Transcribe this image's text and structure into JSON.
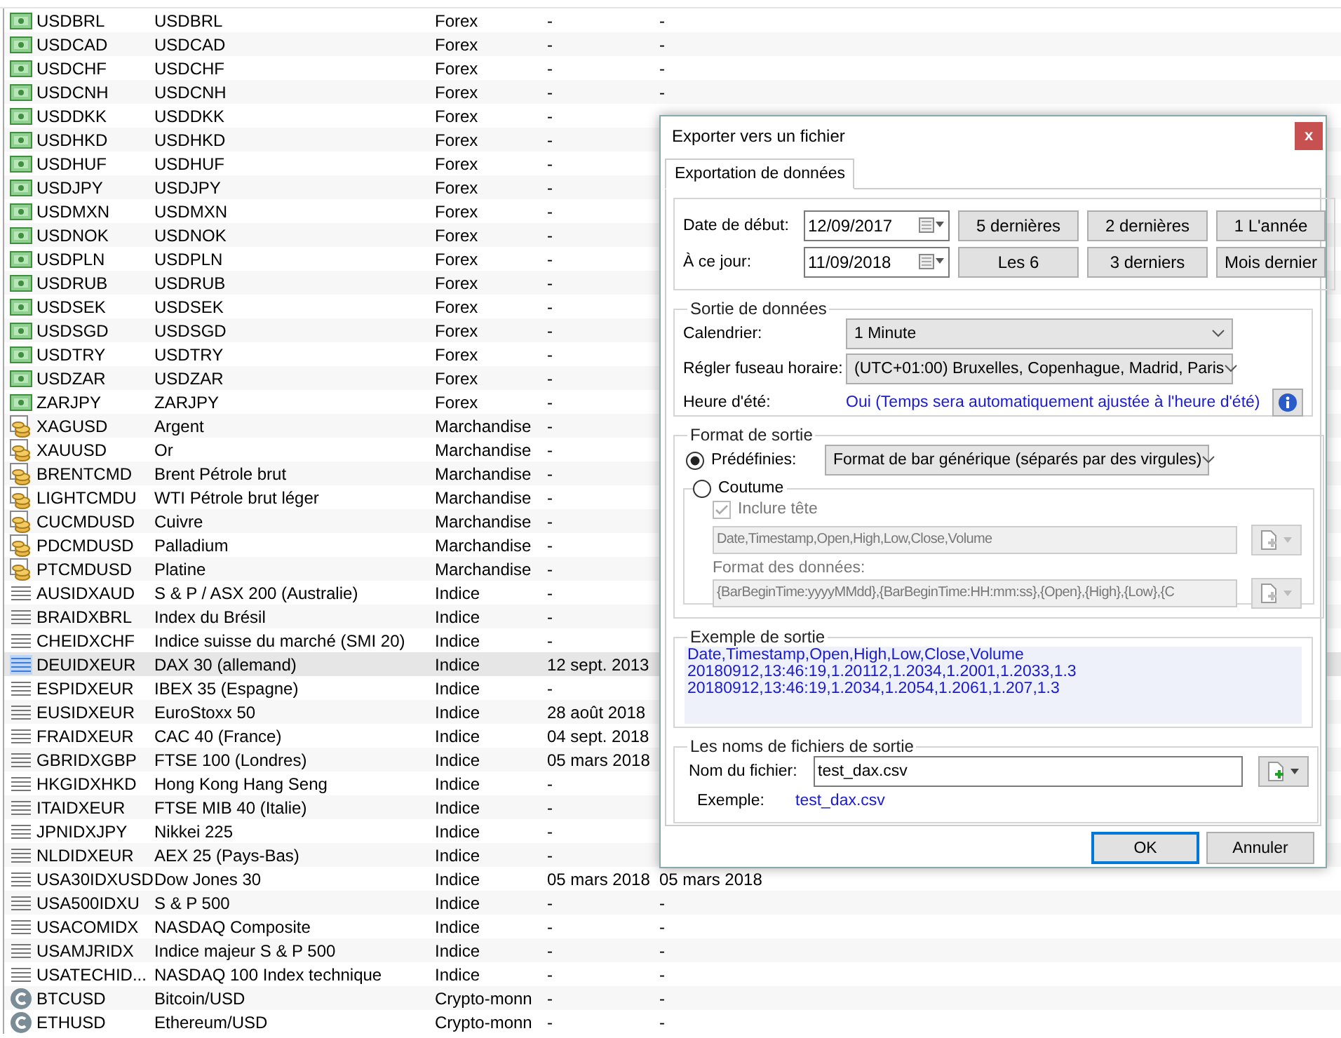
{
  "table": {
    "rows": [
      {
        "kind": "forex",
        "symbol": "USDBRL",
        "name": "USDBRL",
        "type": "Forex",
        "column_4": "-",
        "column_5": "-",
        "selected": false
      },
      {
        "kind": "forex",
        "symbol": "USDCAD",
        "name": "USDCAD",
        "type": "Forex",
        "column_4": "-",
        "column_5": "-",
        "selected": false
      },
      {
        "kind": "forex",
        "symbol": "USDCHF",
        "name": "USDCHF",
        "type": "Forex",
        "column_4": "-",
        "column_5": "-",
        "selected": false
      },
      {
        "kind": "forex",
        "symbol": "USDCNH",
        "name": "USDCNH",
        "type": "Forex",
        "column_4": "-",
        "column_5": "-",
        "selected": false
      },
      {
        "kind": "forex",
        "symbol": "USDDKK",
        "name": "USDDKK",
        "type": "Forex",
        "column_4": "-",
        "selected": false
      },
      {
        "kind": "forex",
        "symbol": "USDHKD",
        "name": "USDHKD",
        "type": "Forex",
        "column_4": "-",
        "selected": false
      },
      {
        "kind": "forex",
        "symbol": "USDHUF",
        "name": "USDHUF",
        "type": "Forex",
        "column_4": "-",
        "selected": false
      },
      {
        "kind": "forex",
        "symbol": "USDJPY",
        "name": "USDJPY",
        "type": "Forex",
        "column_4": "-",
        "selected": false
      },
      {
        "kind": "forex",
        "symbol": "USDMXN",
        "name": "USDMXN",
        "type": "Forex",
        "column_4": "-",
        "selected": false
      },
      {
        "kind": "forex",
        "symbol": "USDNOK",
        "name": "USDNOK",
        "type": "Forex",
        "column_4": "-",
        "selected": false
      },
      {
        "kind": "forex",
        "symbol": "USDPLN",
        "name": "USDPLN",
        "type": "Forex",
        "column_4": "-",
        "selected": false
      },
      {
        "kind": "forex",
        "symbol": "USDRUB",
        "name": "USDRUB",
        "type": "Forex",
        "column_4": "-",
        "selected": false
      },
      {
        "kind": "forex",
        "symbol": "USDSEK",
        "name": "USDSEK",
        "type": "Forex",
        "column_4": "-",
        "selected": false
      },
      {
        "kind": "forex",
        "symbol": "USDSGD",
        "name": "USDSGD",
        "type": "Forex",
        "column_4": "-",
        "selected": false
      },
      {
        "kind": "forex",
        "symbol": "USDTRY",
        "name": "USDTRY",
        "type": "Forex",
        "column_4": "-",
        "selected": false
      },
      {
        "kind": "forex",
        "symbol": "USDZAR",
        "name": "USDZAR",
        "type": "Forex",
        "column_4": "-",
        "selected": false
      },
      {
        "kind": "forex",
        "symbol": "ZARJPY",
        "name": "ZARJPY",
        "type": "Forex",
        "column_4": "-",
        "selected": false
      },
      {
        "kind": "commodity",
        "symbol": "XAGUSD",
        "name": "Argent",
        "type": "Marchandise",
        "column_4": "-",
        "selected": false
      },
      {
        "kind": "commodity",
        "symbol": "XAUUSD",
        "name": "Or",
        "type": "Marchandise",
        "column_4": "-",
        "selected": false
      },
      {
        "kind": "commodity",
        "symbol": "BRENTCMD",
        "name": "Brent Pétrole brut",
        "type": "Marchandise",
        "column_4": "-",
        "selected": false
      },
      {
        "kind": "commodity",
        "symbol": "LIGHTCMDU",
        "name": "WTI Pétrole brut léger",
        "type": "Marchandise",
        "column_4": "-",
        "selected": false
      },
      {
        "kind": "commodity",
        "symbol": "CUCMDUSD",
        "name": "Cuivre",
        "type": "Marchandise",
        "column_4": "-",
        "selected": false
      },
      {
        "kind": "commodity",
        "symbol": "PDCMDUSD",
        "name": "Palladium",
        "type": "Marchandise",
        "column_4": "-",
        "selected": false
      },
      {
        "kind": "commodity",
        "symbol": "PTCMDUSD",
        "name": "Platine",
        "type": "Marchandise",
        "column_4": "-",
        "selected": false
      },
      {
        "kind": "index",
        "symbol": "AUSIDXAUD",
        "name": "S & P / ASX 200 (Australie)",
        "type": "Indice",
        "column_4": "-",
        "selected": false
      },
      {
        "kind": "index",
        "symbol": "BRAIDXBRL",
        "name": "Index du Brésil",
        "type": "Indice",
        "column_4": "-",
        "selected": false
      },
      {
        "kind": "index",
        "symbol": "CHEIDXCHF",
        "name": "Indice suisse du marché (SMI 20)",
        "type": "Indice",
        "column_4": "-",
        "selected": false
      },
      {
        "kind": "index",
        "symbol": "DEUIDXEUR",
        "name": "DAX 30 (allemand)",
        "type": "Indice",
        "column_4": "12 sept. 2013",
        "selected": true
      },
      {
        "kind": "index",
        "symbol": "ESPIDXEUR",
        "name": "IBEX 35 (Espagne)",
        "type": "Indice",
        "column_4": "-",
        "selected": false
      },
      {
        "kind": "index",
        "symbol": "EUSIDXEUR",
        "name": "EuroStoxx 50",
        "type": "Indice",
        "column_4": "28 août 2018",
        "selected": false
      },
      {
        "kind": "index",
        "symbol": "FRAIDXEUR",
        "name": "CAC 40 (France)",
        "type": "Indice",
        "column_4": "04 sept. 2018",
        "selected": false
      },
      {
        "kind": "index",
        "symbol": "GBRIDXGBP",
        "name": "FTSE 100 (Londres)",
        "type": "Indice",
        "column_4": "05 mars 2018",
        "selected": false
      },
      {
        "kind": "index",
        "symbol": "HKGIDXHKD",
        "name": "Hong Kong Hang Seng",
        "type": "Indice",
        "column_4": "-",
        "selected": false
      },
      {
        "kind": "index",
        "symbol": "ITAIDXEUR",
        "name": "FTSE MIB 40 (Italie)",
        "type": "Indice",
        "column_4": "-",
        "selected": false
      },
      {
        "kind": "index",
        "symbol": "JPNIDXJPY",
        "name": "Nikkei 225",
        "type": "Indice",
        "column_4": "-",
        "selected": false
      },
      {
        "kind": "index",
        "symbol": "NLDIDXEUR",
        "name": "AEX 25 (Pays-Bas)",
        "type": "Indice",
        "column_4": "-",
        "selected": false
      },
      {
        "kind": "index",
        "symbol": "USA30IDXUSD",
        "name": "Dow Jones 30",
        "type": "Indice",
        "column_4": "05 mars 2018",
        "column_5": "05 mars 2018",
        "selected": false
      },
      {
        "kind": "index",
        "symbol": "USA500IDXU",
        "name": "S & P 500",
        "type": "Indice",
        "column_4": "-",
        "column_5": "-",
        "selected": false
      },
      {
        "kind": "index",
        "symbol": "USACOMIDX",
        "name": "NASDAQ Composite",
        "type": "Indice",
        "column_4": "-",
        "column_5": "-",
        "selected": false
      },
      {
        "kind": "index",
        "symbol": "USAMJRIDX",
        "name": "Indice majeur S & P 500",
        "type": "Indice",
        "column_4": "-",
        "column_5": "-",
        "selected": false
      },
      {
        "kind": "index",
        "symbol": "USATECHID...",
        "name": "NASDAQ 100 Index technique",
        "type": "Indice",
        "column_4": "-",
        "column_5": "-",
        "selected": false
      },
      {
        "kind": "crypto",
        "symbol": "BTCUSD",
        "name": "Bitcoin/USD",
        "type": "Crypto-monn",
        "column_4": "-",
        "column_5": "-",
        "selected": false
      },
      {
        "kind": "crypto",
        "symbol": "ETHUSD",
        "name": "Ethereum/USD",
        "type": "Crypto-monn",
        "column_4": "-",
        "column_5": "-",
        "selected": false
      }
    ]
  },
  "dialog": {
    "title": "Exporter vers un fichier",
    "close": "x",
    "tabs": [
      {
        "label": "Exportation de données",
        "selected": true
      }
    ],
    "date_range": {
      "start_label": "Date de début:",
      "start_value": "12/09/2017",
      "end_label": "À ce jour:",
      "end_value": "11/09/2018",
      "presets": [
        "5 dernières",
        "2 dernières",
        "1 L'année",
        "Les 6",
        "3 derniers",
        "Mois dernier"
      ]
    },
    "output": {
      "title": "Sortie de données",
      "calendar_label": "Calendrier:",
      "calendar_value": "1 Minute",
      "timezone_label": "Régler fuseau horaire:",
      "timezone_value": "(UTC+01:00) Bruxelles, Copenhague, Madrid, Paris",
      "dst_label": "Heure d'été:",
      "dst_value": "Oui (Temps sera automatiquement ajustée à l'heure d'été)"
    },
    "format": {
      "title": "Format de sortie",
      "predefined": {
        "label": "Prédéfinies:",
        "selected": true,
        "value": "Format de bar générique (séparés par des virgules)"
      },
      "custom": {
        "label": "Coutume",
        "selected": false,
        "disabled": true,
        "include_header": {
          "label": "Inclure tête",
          "checked": true
        },
        "header_value": "Date,Timestamp,Open,High,Low,Close,Volume",
        "data_format_label": "Format des données:",
        "data_format_value": "{BarBeginTime:yyyyMMdd},{BarBeginTime:HH:mm:ss},{Open},{High},{Low},{C"
      }
    },
    "example": {
      "title": "Exemple de sortie",
      "lines": [
        "Date,Timestamp,Open,High,Low,Close,Volume",
        "20180912,13:46:19,1.20112,1.2034,1.2001,1.2033,1.3",
        "20180912,13:46:19,1.2034,1.2054,1.2061,1.207,1.3"
      ]
    },
    "filenames": {
      "title": "Les noms de fichiers de sortie",
      "name_label": "Nom du fichier:",
      "name_value": "test_dax.csv",
      "example_label": "Exemple:",
      "example_value": "test_dax.csv"
    },
    "buttons": [
      {
        "label": "OK",
        "default": true
      },
      {
        "label": "Annuler",
        "default": false
      }
    ]
  }
}
